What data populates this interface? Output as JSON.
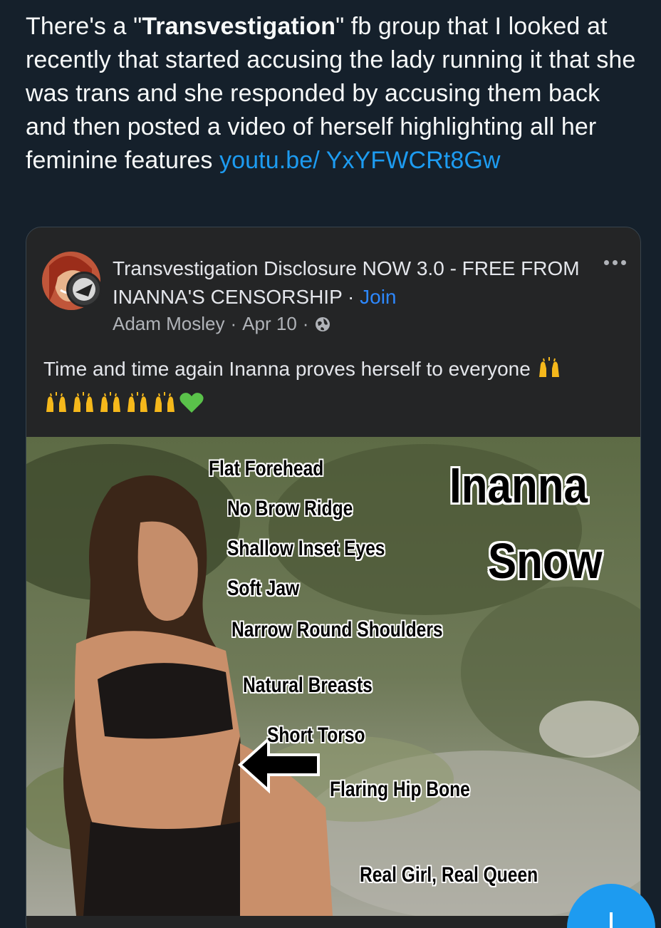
{
  "tweet": {
    "text_part1": "There's a \"",
    "text_bold": "Transvestigation",
    "text_part2": "\" fb group that I looked at recently that started accusing the lady running it that she was trans and she responded by accusing them back and then posted a video of herself highlighting all her feminine features ",
    "link": "youtu.be/ YxYFWCRt8Gw"
  },
  "post": {
    "group_name": "Transvestigation Disclosure NOW 3.0 - FREE FROM INANNA'S CENSORSHIP",
    "separator": "·",
    "join_label": "Join",
    "author": "Adam Mosley",
    "date": "Apr 10",
    "privacy_icon": "globe-icon",
    "body_text": "Time and time again Inanna proves herself to everyone",
    "emoji_icons": [
      "raising-hands-icon",
      "raising-hands-icon",
      "raising-hands-icon",
      "raising-hands-icon",
      "raising-hands-icon",
      "green-heart-icon"
    ]
  },
  "photo": {
    "labels": {
      "flat_forehead": "Flat Forehead",
      "no_brow_ridge": "No Brow Ridge",
      "shallow_inset_eyes": "Shallow Inset Eyes",
      "soft_jaw": "Soft Jaw",
      "narrow_round_shoulders": "Narrow Round Shoulders",
      "natural_breasts": "Natural Breasts",
      "short_torso": "Short Torso",
      "flaring_hip_bone": "Flaring Hip Bone",
      "real_girl": "Real Girl, Real Queen"
    },
    "title_line1": "Inanna",
    "title_line2": "Snow"
  },
  "colors": {
    "background": "#15202b",
    "link": "#1d9bf0",
    "card": "#242526",
    "join": "#2d88ff"
  }
}
